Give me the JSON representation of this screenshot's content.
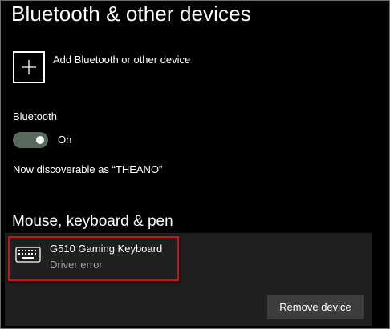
{
  "page": {
    "title": "Bluetooth & other devices"
  },
  "add_device": {
    "label": "Add Bluetooth or other device",
    "icon": "plus-icon"
  },
  "bluetooth": {
    "label": "Bluetooth",
    "toggle_state": "On",
    "toggle_on": true,
    "toggle_color": "#59695c",
    "discoverable_text": "Now discoverable as “THEANO”"
  },
  "section": {
    "title": "Mouse, keyboard & pen"
  },
  "devices": [
    {
      "name": "G510 Gaming Keyboard",
      "status": "Driver error",
      "icon": "keyboard-icon",
      "highlight_color": "#c8131b"
    }
  ],
  "actions": {
    "remove_label": "Remove device"
  }
}
